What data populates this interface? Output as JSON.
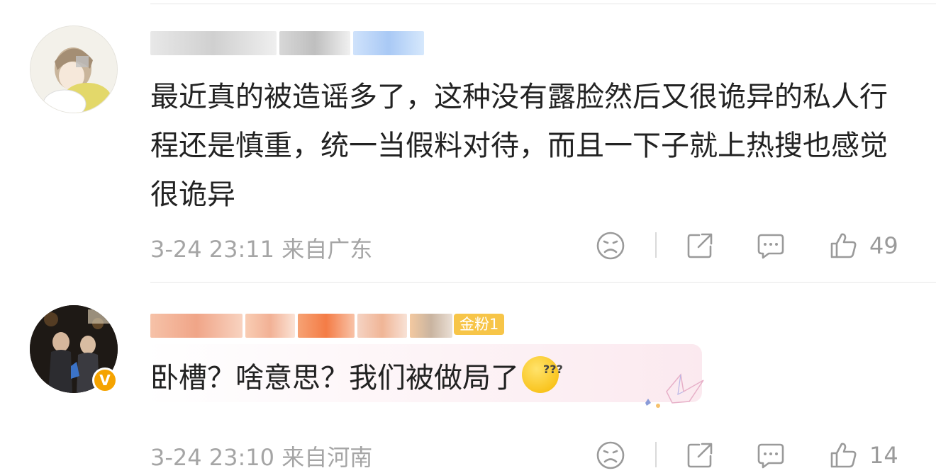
{
  "comments": [
    {
      "text": "最近真的被造谣多了，这种没有露脸然后又很诡异的私人行程还是慎重，统一当假料对待，而且一下子就上热搜也感觉很诡异",
      "time": "3-24 23:11",
      "location": "来自广东",
      "likes": "49",
      "avatar_icon": "avatar-anime-girl",
      "blurred_name": true
    },
    {
      "text": "卧槽？啥意思？我们被做局了",
      "time": "3-24 23:10",
      "location": "来自河南",
      "likes": "14",
      "fan_badge": "金粉1",
      "verified": "V",
      "avatar_icon": "avatar-award-photo",
      "blurred_name": true,
      "accent": "#f5a300"
    }
  ],
  "icons": [
    "sad-face-icon",
    "share-icon",
    "comment-icon",
    "thumbs-up-icon",
    "emoji-sleepy-icon",
    "paper-crane-icon"
  ]
}
